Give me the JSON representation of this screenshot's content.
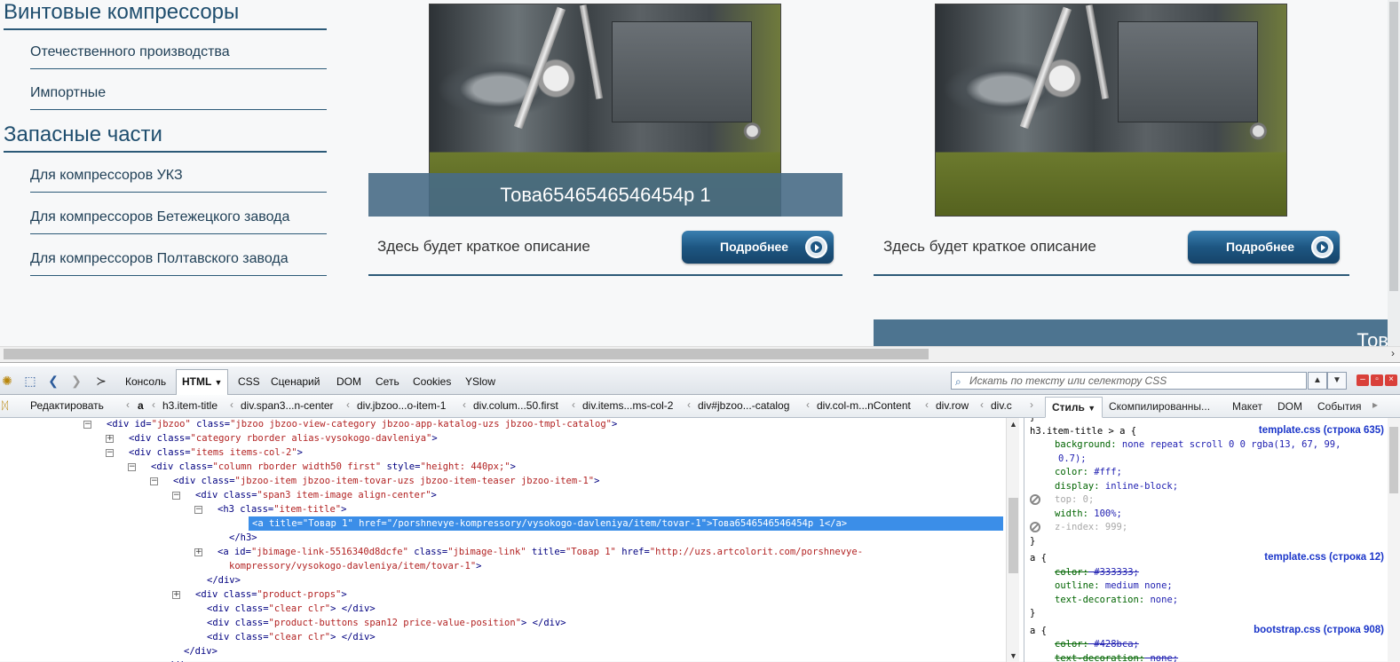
{
  "sidebar": {
    "heading1": "Винтовые компрессоры",
    "links1": [
      "Отечественного производства",
      "Импортные"
    ],
    "heading2": "Запасные части",
    "links2": [
      "Для компрессоров УКЗ",
      "Для компрессоров Бетежецкого завода",
      "Для компрессоров Полтавского завода"
    ]
  },
  "products": [
    {
      "title": "Това6546546546454р 1",
      "desc": "Здесь будет краткое описание",
      "button": "Подробнее"
    },
    {
      "title": "",
      "desc": "Здесь будет краткое описание",
      "button": "Подробнее"
    }
  ],
  "next_item_title": "Тов",
  "firebug": {
    "tabs": [
      "Консоль",
      "HTML",
      "CSS",
      "Сценарий",
      "DOM",
      "Сеть",
      "Cookies",
      "YSlow"
    ],
    "search_placeholder": "Искать по тексту или селектору CSS",
    "edit_button": "Редактировать",
    "breadcrumbs": [
      "a",
      "h3.item-title",
      "div.span3...n-center",
      "div.jbzoo...o-item-1",
      "div.colum...50.first",
      "div.items...ms-col-2",
      "div#jbzoo...-catalog",
      "div.col-m...nContent",
      "div.row",
      "div.c"
    ],
    "side_tabs": [
      "Стиль",
      "Скомпилированны...",
      "Макет",
      "DOM",
      "События"
    ],
    "html_lines": [
      {
        "tw": "−",
        "parts": [
          [
            "t",
            "<div "
          ],
          [
            "n",
            "id="
          ],
          [
            "v",
            "\"jbzoo\" "
          ],
          [
            "n",
            "class="
          ],
          [
            "v",
            "\"jbzoo jbzoo-view-category jbzoo-app-katalog-uzs jbzoo-tmpl-catalog\""
          ],
          [
            "t",
            ">"
          ]
        ]
      },
      {
        "tw": "+",
        "parts": [
          [
            "t",
            "<div "
          ],
          [
            "n",
            "class="
          ],
          [
            "v",
            "\"category rborder alias-vysokogo-davleniya\""
          ],
          [
            "t",
            ">"
          ]
        ]
      },
      {
        "tw": "−",
        "parts": [
          [
            "t",
            "<div "
          ],
          [
            "n",
            "class="
          ],
          [
            "v",
            "\"items items-col-2\""
          ],
          [
            "t",
            ">"
          ]
        ]
      },
      {
        "tw": "−",
        "parts": [
          [
            "t",
            "<div "
          ],
          [
            "n",
            "class="
          ],
          [
            "v",
            "\"column rborder width50 first\" "
          ],
          [
            "n",
            "style="
          ],
          [
            "v",
            "\"height: 440px;\""
          ],
          [
            "t",
            ">"
          ]
        ]
      },
      {
        "tw": "−",
        "parts": [
          [
            "t",
            "<div "
          ],
          [
            "n",
            "class="
          ],
          [
            "v",
            "\"jbzoo-item jbzoo-item-tovar-uzs jbzoo-item-teaser jbzoo-item-1\""
          ],
          [
            "t",
            ">"
          ]
        ]
      },
      {
        "tw": "−",
        "parts": [
          [
            "t",
            "<div "
          ],
          [
            "n",
            "class="
          ],
          [
            "v",
            "\"span3 item-image align-center\""
          ],
          [
            "t",
            ">"
          ]
        ]
      },
      {
        "tw": "−",
        "parts": [
          [
            "t",
            "<h3 "
          ],
          [
            "n",
            "class="
          ],
          [
            "v",
            "\"item-title\""
          ],
          [
            "t",
            ">"
          ]
        ]
      },
      {
        "tw": "",
        "parts": [
          [
            "t",
            "<a "
          ],
          [
            "n",
            "title="
          ],
          [
            "v",
            "\"Товар 1\" "
          ],
          [
            "n",
            "href="
          ],
          [
            "v",
            "\"/porshnevye-kompressory/vysokogo-davleniya/item/tovar-1\""
          ],
          [
            "t",
            ">Това6546546546454р 1</a>"
          ]
        ]
      },
      {
        "tw": "",
        "parts": [
          [
            "t",
            "</h3>"
          ]
        ]
      },
      {
        "tw": "+",
        "parts": [
          [
            "t",
            "<a "
          ],
          [
            "n",
            "id="
          ],
          [
            "v",
            "\"jbimage-link-5516340d8dcfe\" "
          ],
          [
            "n",
            "class="
          ],
          [
            "v",
            "\"jbimage-link\" "
          ],
          [
            "n",
            "title="
          ],
          [
            "v",
            "\"Товар 1\" "
          ],
          [
            "n",
            "href="
          ],
          [
            "v",
            "\"http://uzs.artcolorit.com/porshnevye-"
          ]
        ]
      },
      {
        "tw": "",
        "parts": [
          [
            "v",
            "kompressory/vysokogo-davleniya/item/tovar-1\""
          ],
          [
            "t",
            ">"
          ]
        ]
      },
      {
        "tw": "",
        "parts": [
          [
            "t",
            "</div>"
          ]
        ]
      },
      {
        "tw": "+",
        "parts": [
          [
            "t",
            "<div "
          ],
          [
            "n",
            "class="
          ],
          [
            "v",
            "\"product-props\""
          ],
          [
            "t",
            ">"
          ]
        ]
      },
      {
        "tw": "",
        "parts": [
          [
            "t",
            "<div "
          ],
          [
            "n",
            "class="
          ],
          [
            "v",
            "\"clear clr\""
          ],
          [
            "t",
            "> </div>"
          ]
        ]
      },
      {
        "tw": "",
        "parts": [
          [
            "t",
            "<div "
          ],
          [
            "n",
            "class="
          ],
          [
            "v",
            "\"product-buttons span12 price-value-position\""
          ],
          [
            "t",
            ">  </div>"
          ]
        ]
      },
      {
        "tw": "",
        "parts": [
          [
            "t",
            "<div "
          ],
          [
            "n",
            "class="
          ],
          [
            "v",
            "\"clear clr\""
          ],
          [
            "t",
            "> </div>"
          ]
        ]
      },
      {
        "tw": "",
        "parts": [
          [
            "t",
            "</div>"
          ]
        ]
      },
      {
        "tw": "",
        "parts": [
          [
            "t",
            "</div>"
          ]
        ]
      }
    ],
    "css_rules": [
      {
        "lines": [
          {
            "text": "}",
            "cls": ""
          }
        ]
      },
      {
        "selector": "h3.item-title > a {",
        "source": "template.css (строка 635)",
        "lines": [
          {
            "text": "background: none repeat scroll 0 0 rgba(13, 67, 99,",
            "cls": "decl"
          },
          {
            "text": "0.7);",
            "cls": "cont"
          },
          {
            "text": "color: #fff;",
            "cls": "decl"
          },
          {
            "text": "display: inline-block;",
            "cls": "decl"
          },
          {
            "text": "top: 0;",
            "cls": "dis"
          },
          {
            "text": "width: 100%;",
            "cls": "decl"
          },
          {
            "text": "z-index: 999;",
            "cls": "dis"
          },
          {
            "text": "}",
            "cls": ""
          }
        ]
      },
      {
        "selector": "a {",
        "source": "template.css (строка 12)",
        "lines": [
          {
            "text": "color: #333333;",
            "cls": "strike"
          },
          {
            "text": "outline: medium none;",
            "cls": "decl"
          },
          {
            "text": "text-decoration: none;",
            "cls": "decl"
          },
          {
            "text": "}",
            "cls": ""
          }
        ]
      },
      {
        "selector": "a {",
        "source": "bootstrap.css (строка 908)",
        "lines": [
          {
            "text": "color: #428bca;",
            "cls": "strike"
          },
          {
            "text": "text-decoration: none;",
            "cls": "strike"
          }
        ]
      }
    ]
  }
}
